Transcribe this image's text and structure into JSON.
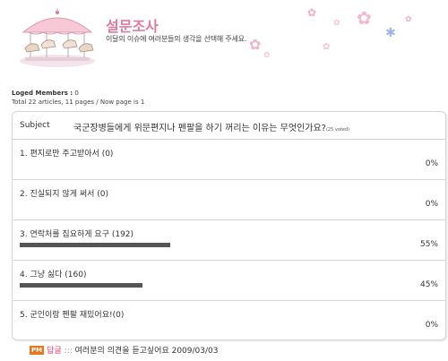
{
  "banner": {
    "title": "설문조사",
    "subtitle": "이달의 이슈에 여러분들의 생각을 선택해 주세요."
  },
  "meta": {
    "members_label": "Loged Members :",
    "members_value": "0",
    "total_line": "Total 22 articles, 11 pages / Now page is 1"
  },
  "poll": {
    "subject_label": "Subject",
    "question": "국군장병들에게 위문편지나 펜팔을 하기 꺼리는 이유는 무엇인가요?",
    "voted": "(25 voted)",
    "options": [
      {
        "label": "1. 편지로만 주고받아서 (0)",
        "percent_text": "0%",
        "fraction": 0
      },
      {
        "label": "2. 진실되지 않게 써서 (0)",
        "percent_text": "0%",
        "fraction": 0
      },
      {
        "label": "3. 연락처를 집요하게 요구 (192)",
        "percent_text": "55%",
        "fraction": 0.55
      },
      {
        "label": "4. 그냥 싫다 (160)",
        "percent_text": "45%",
        "fraction": 0.45
      },
      {
        "label": "5. 군인이랑 펜팔 재밌어요!(0)",
        "percent_text": "0%",
        "fraction": 0
      }
    ]
  },
  "footer": {
    "badge": "PM",
    "reply_tag": "답글",
    "separator": ":::",
    "text": "여러분의 의견을 듣고싶어요 2009/03/03"
  },
  "colors": {
    "accent": "#e07a9a",
    "bar": "#555555",
    "badge": "#e8761f"
  }
}
